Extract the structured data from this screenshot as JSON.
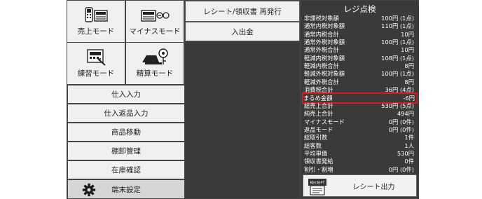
{
  "left": {
    "modes": [
      {
        "label": "売上モード",
        "icon": "sales-register-icon"
      },
      {
        "label": "マイナスモード",
        "icon": "minus-register-icon"
      },
      {
        "label": "練習モード",
        "icon": "practice-register-icon"
      },
      {
        "label": "精算モード",
        "icon": "settlement-key-icon"
      }
    ],
    "buttons": [
      "仕入入力",
      "仕入返品入力",
      "商品移動",
      "棚卸管理",
      "在庫確認"
    ],
    "terminal": {
      "label": "端末設定",
      "icon": "gear-icon"
    }
  },
  "middle": {
    "reissue_label": "レシート/領収書 再発行",
    "cash_label": "入出金"
  },
  "right": {
    "title": "レジ点検",
    "rows": [
      {
        "label": "非課税対象額",
        "value": "100円 (1点)"
      },
      {
        "label": "通常内税対象額",
        "value": "110円 (1点)"
      },
      {
        "label": "通常内税合計",
        "value": "10円"
      },
      {
        "label": "通常外税対象額",
        "value": "100円 (1点)"
      },
      {
        "label": "通常外税合計",
        "value": "10円"
      },
      {
        "label": "軽減内税対象額",
        "value": "108円 (1点)"
      },
      {
        "label": "軽減内税合計",
        "value": "8円"
      },
      {
        "label": "軽減外税対象額",
        "value": "100円 (1点)"
      },
      {
        "label": "軽減外税合計",
        "value": "8円"
      },
      {
        "label": "消費税合計",
        "value": "36円 (4点)"
      },
      {
        "label": "まるめ金額",
        "value": "-6円"
      },
      {
        "label": "総売上合計",
        "value": "530円 (5点)"
      },
      {
        "label": "純売上合計",
        "value": "494円"
      },
      {
        "label": "マイナスモード",
        "value": "0円 (0件)"
      },
      {
        "label": "返品モード",
        "value": "0円 (0件)"
      },
      {
        "label": "総取引数",
        "value": "1件"
      },
      {
        "label": "総客数",
        "value": "1人"
      },
      {
        "label": "平均単価",
        "value": "530円"
      },
      {
        "label": "領収書発給",
        "value": "0件"
      },
      {
        "label": "割引・割増",
        "value": "0円 (0件)"
      }
    ],
    "highlight_index": 10,
    "highlight_color": "#e01a1a",
    "receipt_button": {
      "label": "レシート出力",
      "icon_text": "RECEIPT",
      "icon": "receipt-printer-icon"
    }
  }
}
